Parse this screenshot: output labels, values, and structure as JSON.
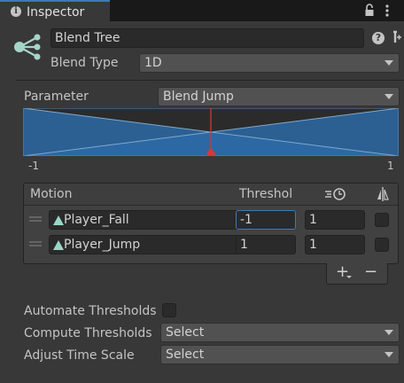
{
  "tab": {
    "title": "Inspector",
    "info_icon": "info-icon"
  },
  "header": {
    "name_value": "Blend Tree",
    "blend_type_label": "Blend Type",
    "blend_type_value": "1D"
  },
  "graph": {
    "parameter_label": "Parameter",
    "parameter_value": "Blend Jump",
    "min_label": "-1",
    "max_label": "1"
  },
  "motion_table": {
    "headers": [
      "Motion",
      "Threshol"
    ],
    "rows": [
      {
        "clip": "Player_Fall",
        "threshold": "-1",
        "speed": "1"
      },
      {
        "clip": "Player_Jump",
        "threshold": "1",
        "speed": "1"
      }
    ],
    "add_label": "+",
    "remove_label": "−"
  },
  "settings": {
    "automate_label": "Automate Thresholds",
    "compute_label": "Compute Thresholds",
    "compute_value": "Select",
    "adjust_label": "Adjust Time Scale",
    "adjust_value": "Select"
  },
  "colors": {
    "accent": "#3a79bb",
    "blend_fill": "#2d6aa6",
    "marker": "#d23a3a"
  }
}
